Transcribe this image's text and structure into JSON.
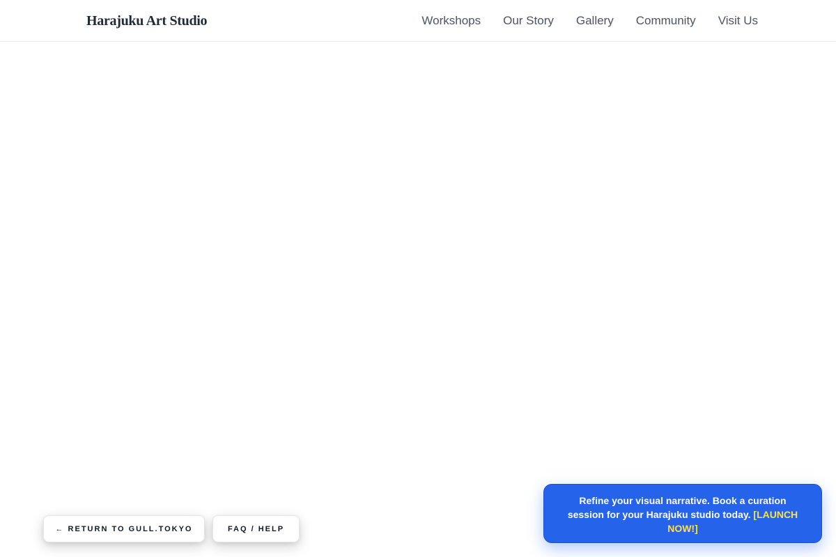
{
  "brand": {
    "name": "Harajuku Art Studio"
  },
  "nav": {
    "items": [
      {
        "label": "Workshops"
      },
      {
        "label": "Our Story"
      },
      {
        "label": "Gallery"
      },
      {
        "label": "Community"
      },
      {
        "label": "Visit Us"
      }
    ]
  },
  "footer_actions": {
    "return_label": "← RETURN TO GULL.TOKYO",
    "faq_label": "FAQ / HELP"
  },
  "promo": {
    "text": "Refine your visual narrative. Book a curation session for your Harajuku studio today.",
    "cta": "[LAUNCH NOW!]"
  },
  "colors": {
    "promo_background": "#2563eb",
    "promo_cta": "#fde047",
    "brand_text": "#1f2937",
    "nav_text": "#4b5563"
  }
}
